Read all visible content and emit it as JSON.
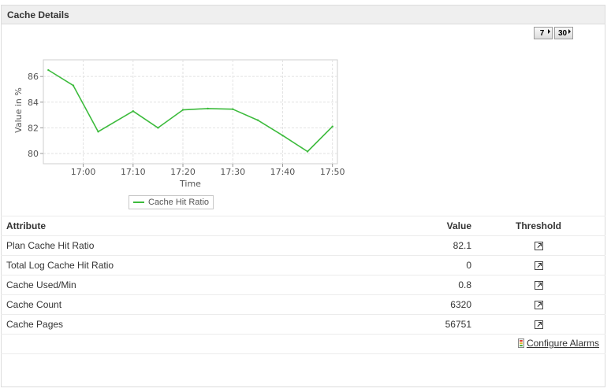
{
  "panel": {
    "title": "Cache Details"
  },
  "period_buttons": [
    {
      "label": "7"
    },
    {
      "label": "30"
    }
  ],
  "chart_data": {
    "type": "line",
    "xlabel": "Time",
    "ylabel": "Value in %",
    "x_ticks": [
      "17:00",
      "17:10",
      "17:20",
      "17:30",
      "17:40",
      "17:50"
    ],
    "y_ticks": [
      80,
      82,
      84,
      86
    ],
    "xlim": [
      "16:52",
      "17:51"
    ],
    "ylim": [
      79.2,
      87.3
    ],
    "grid": true,
    "legend": "bottom",
    "series": [
      {
        "name": "Cache Hit Ratio",
        "color": "#3dbb3d",
        "x": [
          "16:53",
          "16:58",
          "17:03",
          "17:10",
          "17:15",
          "17:20",
          "17:25",
          "17:30",
          "17:35",
          "17:40",
          "17:45",
          "17:50"
        ],
        "y": [
          86.5,
          85.3,
          81.7,
          83.3,
          82.0,
          83.4,
          83.5,
          83.45,
          82.6,
          81.4,
          80.15,
          82.1
        ]
      }
    ]
  },
  "table": {
    "headers": {
      "attribute": "Attribute",
      "value": "Value",
      "threshold": "Threshold"
    },
    "rows": [
      {
        "attribute": "Plan Cache Hit Ratio",
        "value": "82.1"
      },
      {
        "attribute": "Total Log Cache Hit Ratio",
        "value": "0"
      },
      {
        "attribute": "Cache Used/Min",
        "value": "0.8"
      },
      {
        "attribute": "Cache Count",
        "value": "6320"
      },
      {
        "attribute": "Cache Pages",
        "value": "56751"
      }
    ]
  },
  "footer": {
    "configure_alarms": "Configure Alarms"
  },
  "icons": {
    "threshold": "threshold-edit-icon",
    "alarm": "traffic-light-icon"
  }
}
